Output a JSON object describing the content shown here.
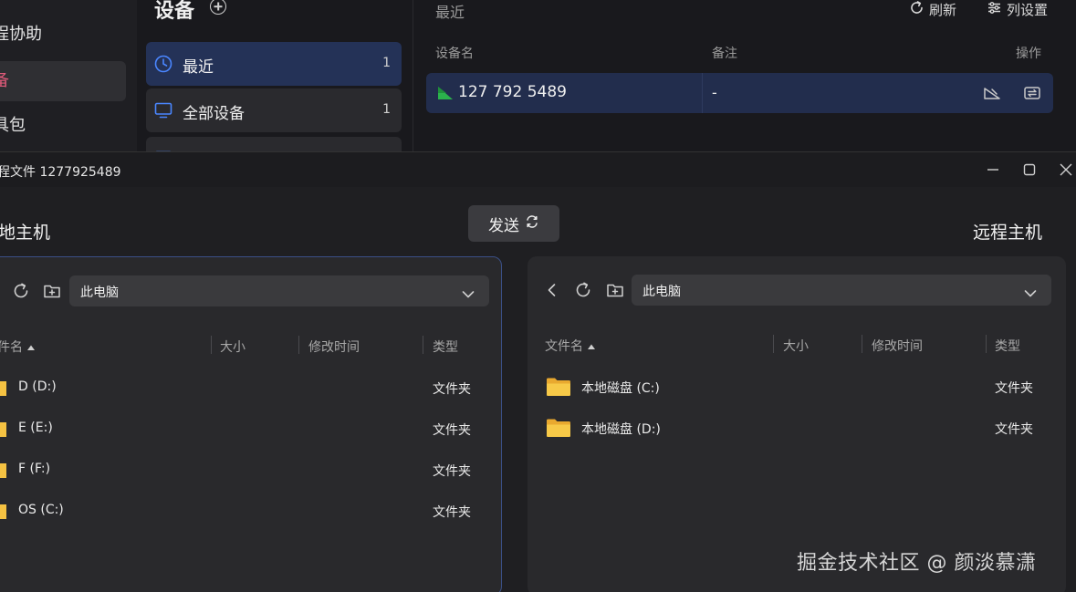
{
  "nav": {
    "items": [
      {
        "label": "程协助"
      },
      {
        "label": "备"
      },
      {
        "label": "具包"
      }
    ]
  },
  "groups": {
    "title": "设备",
    "items": [
      {
        "label": "最近",
        "count": "1"
      },
      {
        "label": "全部设备",
        "count": "1"
      }
    ]
  },
  "devices": {
    "breadcrumb": "最近",
    "refresh_label": "刷新",
    "columns_label": "列设置",
    "headers": {
      "name": "设备名",
      "remark": "备注",
      "action": "操作"
    },
    "rows": [
      {
        "name": "127 792 5489",
        "remark": "-"
      }
    ]
  },
  "file_transfer": {
    "title": "程文件 1277925489",
    "local_title": "地主机",
    "remote_title": "远程主机",
    "send_label": "发送",
    "local": {
      "path": "此电脑",
      "headers": {
        "name": "件名",
        "size": "大小",
        "modified": "修改时间",
        "type": "类型"
      },
      "rows": [
        {
          "name": "D (D:)",
          "type": "文件夹"
        },
        {
          "name": "E (E:)",
          "type": "文件夹"
        },
        {
          "name": "F (F:)",
          "type": "文件夹"
        },
        {
          "name": "OS (C:)",
          "type": "文件夹"
        }
      ]
    },
    "remote": {
      "path": "此电脑",
      "headers": {
        "name": "文件名",
        "size": "大小",
        "modified": "修改时间",
        "type": "类型"
      },
      "rows": [
        {
          "name": "本地磁盘 (C:)",
          "type": "文件夹"
        },
        {
          "name": "本地磁盘 (D:)",
          "type": "文件夹"
        }
      ]
    }
  },
  "watermark": "掘金技术社区 @ 颜淡慕潇",
  "colors": {
    "accent_blue": "#3a6ee8",
    "active_nav": "#e05a7a",
    "device_online": "#2bb24c",
    "folder": "#f5c242"
  }
}
